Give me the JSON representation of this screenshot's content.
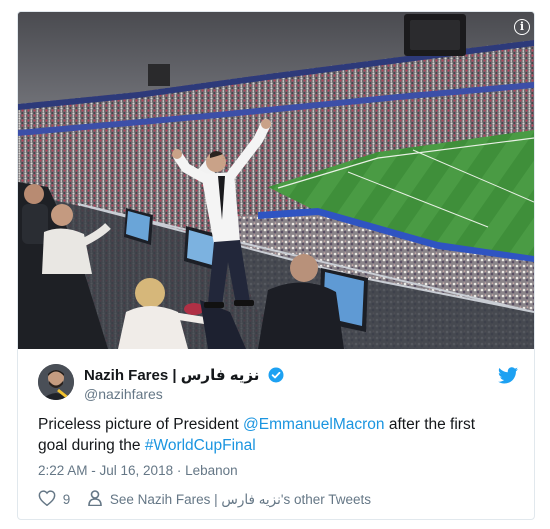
{
  "tweet": {
    "display_name": "Nazih Fares | نزيه فارس",
    "handle": "@nazihfares",
    "text_parts": {
      "t1": "Priceless picture of President ",
      "mention": "@EmmanuelMacron",
      "t2": " after the first goal during the ",
      "hashtag": "#WorldCupFinal"
    },
    "timestamp": "2:22 AM - Jul 16, 2018 · Lebanon",
    "likes": "9",
    "other_tweets_label": "See Nazih Fares | نزيه فارس's other Tweets"
  },
  "icons": {
    "info": "info-icon",
    "verified": "verified-badge-icon",
    "brand": "twitter-bird-icon",
    "like": "heart-icon",
    "profile": "person-icon"
  },
  "colors": {
    "link": "#1b95e0",
    "verified": "#1da1f2",
    "muted": "#657786",
    "text": "#14171a",
    "pitch": "#3f8f3a"
  }
}
